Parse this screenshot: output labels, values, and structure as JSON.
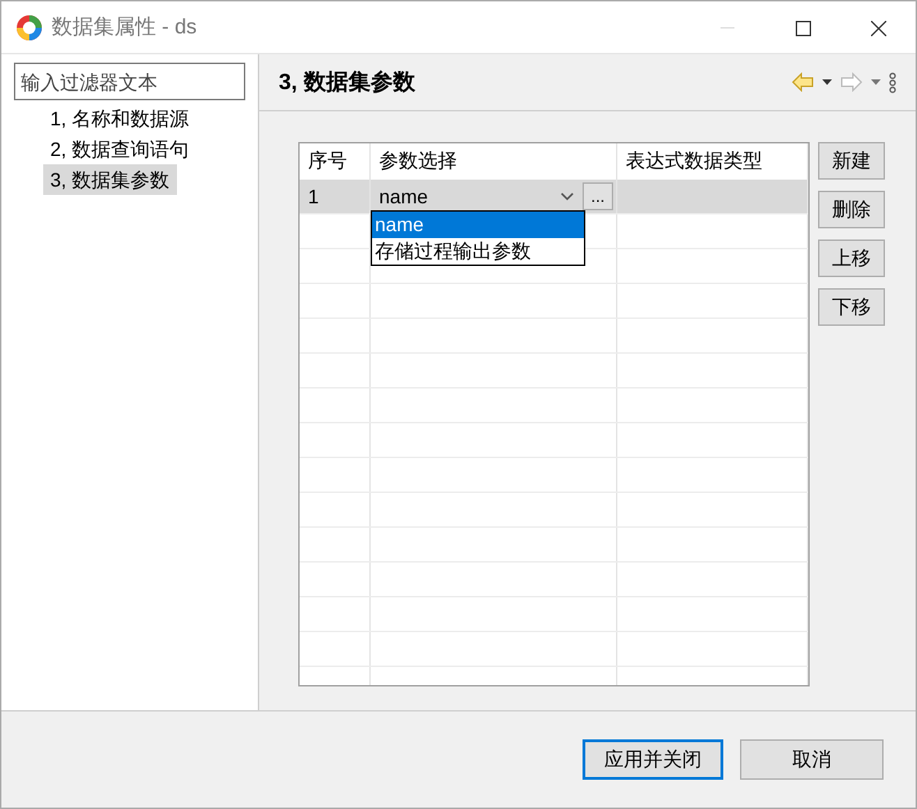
{
  "window": {
    "title": "数据集属性 - ds"
  },
  "sidebar": {
    "filter": {
      "placeholder": "输入过滤器文本"
    },
    "items": [
      {
        "label": "1, 名称和数据源",
        "selected": false
      },
      {
        "label": "2, 数据查询语句",
        "selected": false
      },
      {
        "label": "3, 数据集参数",
        "selected": true
      }
    ]
  },
  "page": {
    "title": "3, 数据集参数"
  },
  "table": {
    "columns": [
      "序号",
      "参数选择",
      "表达式数据类型"
    ],
    "rows": [
      {
        "index": "1",
        "parameter": "name",
        "selected": true
      }
    ],
    "dropdown": {
      "options": [
        {
          "label": "name",
          "selected": true
        },
        {
          "label": "存储过程输出参数",
          "selected": false
        }
      ]
    },
    "browse_button": "..."
  },
  "side_buttons": [
    "新建",
    "删除",
    "上移",
    "下移"
  ],
  "footer_buttons": [
    {
      "label": "应用并关闭",
      "kind": "primary"
    },
    {
      "label": "取消",
      "kind": "normal"
    }
  ]
}
